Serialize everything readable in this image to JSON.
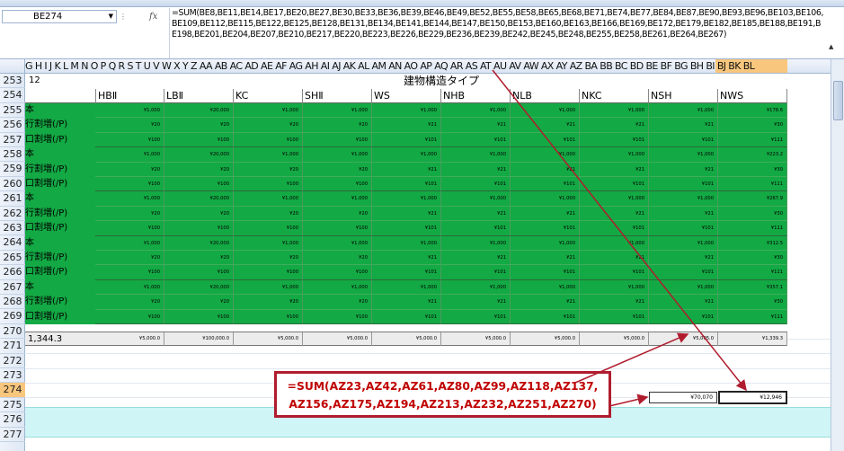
{
  "window": {
    "name_box": "BE274",
    "fx_label": "fx",
    "formula": "=SUM(BE8,BE11,BE14,BE17,BE20,BE27,BE30,BE33,BE36,BE39,BE46,BE49,BE52,BE55,BE58,BE65,BE68,BE71,BE74,BE77,BE84,BE87,BE90,BE93,BE96,BE103,BE106,BE109,BE112,BE115,BE122,BE125,BE128,BE131,BE134,BE141,BE144,BE147,BE150,BE153,BE160,BE163,BE166,BE169,BE172,BE179,BE182,BE185,BE188,BE191,BE198,BE201,BE204,BE207,BE210,BE217,BE220,BE223,BE226,BE229,BE236,BE239,BE242,BE245,BE248,BE255,BE258,BE261,BE264,BE267)"
  },
  "columns": {
    "letters": "G H I J K L M N O P Q R S T U V W X Y Z AA AB AC AD AE AF AG AH AI AJ AK AL AM AN AO AP AQ AR AS AT AU AV AW AX AY AZ BA BB BC BD BE BF BG BH BI BJ BK BL",
    "selected": "BE"
  },
  "rows": [
    "253",
    "254",
    "255",
    "256",
    "257",
    "258",
    "259",
    "260",
    "261",
    "262",
    "263",
    "264",
    "265",
    "266",
    "267",
    "268",
    "269",
    "270",
    "271",
    "272",
    "273",
    "274",
    "275",
    "276",
    "277"
  ],
  "selected_row": "274",
  "sheet": {
    "corner_value": "12",
    "title": "建物構造タイプ",
    "types": [
      "HBⅡ",
      "LBⅡ",
      "KC",
      "SHⅡ",
      "WS",
      "NHB",
      "NLB",
      "NKC",
      "NSH",
      "NWS"
    ],
    "row_labels": [
      "本",
      "行割増(/P)",
      "口割増(/P)"
    ],
    "value_rows": [
      [
        "¥1,000",
        "¥20,000",
        "¥1,000",
        "¥1,000",
        "¥1,000",
        "¥1,000",
        "¥1,000",
        "¥1,000",
        "¥1,000",
        "¥178.6"
      ],
      [
        "¥20",
        "¥20",
        "¥20",
        "¥20",
        "¥21",
        "¥21",
        "¥21",
        "¥21",
        "¥21",
        "¥30"
      ],
      [
        "¥100",
        "¥100",
        "¥100",
        "¥100",
        "¥101",
        "¥101",
        "¥101",
        "¥101",
        "¥101",
        "¥111"
      ],
      [
        "¥1,000",
        "¥20,000",
        "¥1,000",
        "¥1,000",
        "¥1,000",
        "¥1,000",
        "¥1,000",
        "¥1,000",
        "¥1,000",
        "¥223.2"
      ],
      [
        "¥20",
        "¥20",
        "¥20",
        "¥20",
        "¥21",
        "¥21",
        "¥21",
        "¥21",
        "¥21",
        "¥30"
      ],
      [
        "¥100",
        "¥100",
        "¥100",
        "¥100",
        "¥101",
        "¥101",
        "¥101",
        "¥101",
        "¥101",
        "¥111"
      ],
      [
        "¥1,000",
        "¥20,000",
        "¥1,000",
        "¥1,000",
        "¥1,000",
        "¥1,000",
        "¥1,000",
        "¥1,000",
        "¥1,000",
        "¥267.9"
      ],
      [
        "¥20",
        "¥20",
        "¥20",
        "¥20",
        "¥21",
        "¥21",
        "¥21",
        "¥21",
        "¥21",
        "¥30"
      ],
      [
        "¥100",
        "¥100",
        "¥100",
        "¥100",
        "¥101",
        "¥101",
        "¥101",
        "¥101",
        "¥101",
        "¥111"
      ],
      [
        "¥1,000",
        "¥20,000",
        "¥1,000",
        "¥1,000",
        "¥1,000",
        "¥1,000",
        "¥1,000",
        "¥1,000",
        "¥1,000",
        "¥312.5"
      ],
      [
        "¥20",
        "¥20",
        "¥20",
        "¥20",
        "¥21",
        "¥21",
        "¥21",
        "¥21",
        "¥21",
        "¥30"
      ],
      [
        "¥100",
        "¥100",
        "¥100",
        "¥100",
        "¥101",
        "¥101",
        "¥101",
        "¥101",
        "¥101",
        "¥111"
      ],
      [
        "¥1,000",
        "¥20,000",
        "¥1,000",
        "¥1,000",
        "¥1,000",
        "¥1,000",
        "¥1,000",
        "¥1,000",
        "¥1,000",
        "¥357.1"
      ],
      [
        "¥20",
        "¥20",
        "¥20",
        "¥20",
        "¥21",
        "¥21",
        "¥21",
        "¥21",
        "¥21",
        "¥30"
      ],
      [
        "¥100",
        "¥100",
        "¥100",
        "¥100",
        "¥101",
        "¥101",
        "¥101",
        "¥101",
        "¥101",
        "¥111"
      ]
    ],
    "row270_label": "1,344.3",
    "row270_values": [
      "¥5,000.0",
      "¥100,000.0",
      "¥5,000.0",
      "¥5,000.0",
      "¥5,000.0",
      "¥5,000.0",
      "¥5,000.0",
      "¥5,000.0",
      "¥5,005.0",
      "¥1,339.3"
    ],
    "sum_az274": "¥70,070",
    "sum_be274": "¥12,946"
  },
  "callout": {
    "line1": "=SUM(AZ23,AZ42,AZ61,AZ80,AZ99,AZ118,AZ137,",
    "line2": "AZ156,AZ175,AZ194,AZ213,AZ232,AZ251,AZ270)"
  },
  "colors": {
    "green": "#13a944",
    "accent_red": "#b01c2e",
    "selection": "#f8c77d",
    "band": "#cff5f6"
  }
}
